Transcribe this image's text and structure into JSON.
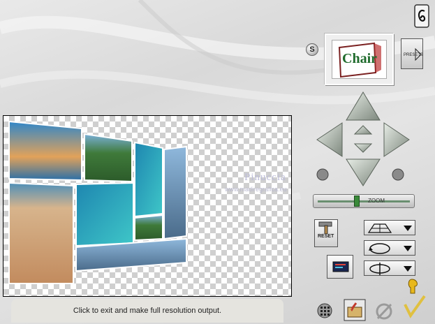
{
  "status_bar": {
    "text": "Click to exit and make full resolution output."
  },
  "watermark": {
    "line1": "Pinuccia",
    "line2": "www.madiregrafica.eu"
  },
  "thumbnail": {
    "title": "Chair"
  },
  "presets": {
    "label": "PRESETS"
  },
  "badge": {
    "letter": "S"
  },
  "reset": {
    "label": "RESET"
  },
  "zoom": {
    "label": "ZOOM",
    "value_percent": 42
  },
  "dropdowns": [
    {
      "icon": "grid-plane-icon"
    },
    {
      "icon": "rotate-circle-icon"
    },
    {
      "icon": "rotate-axis-icon"
    }
  ],
  "bottom": {
    "icons": [
      "grid-dots-icon",
      "open-file-icon",
      "cancel-icon",
      "ok-check-icon"
    ]
  },
  "colors": {
    "accent_green": "#3a8a3a",
    "arrow_gray": "#a9b2a8"
  }
}
